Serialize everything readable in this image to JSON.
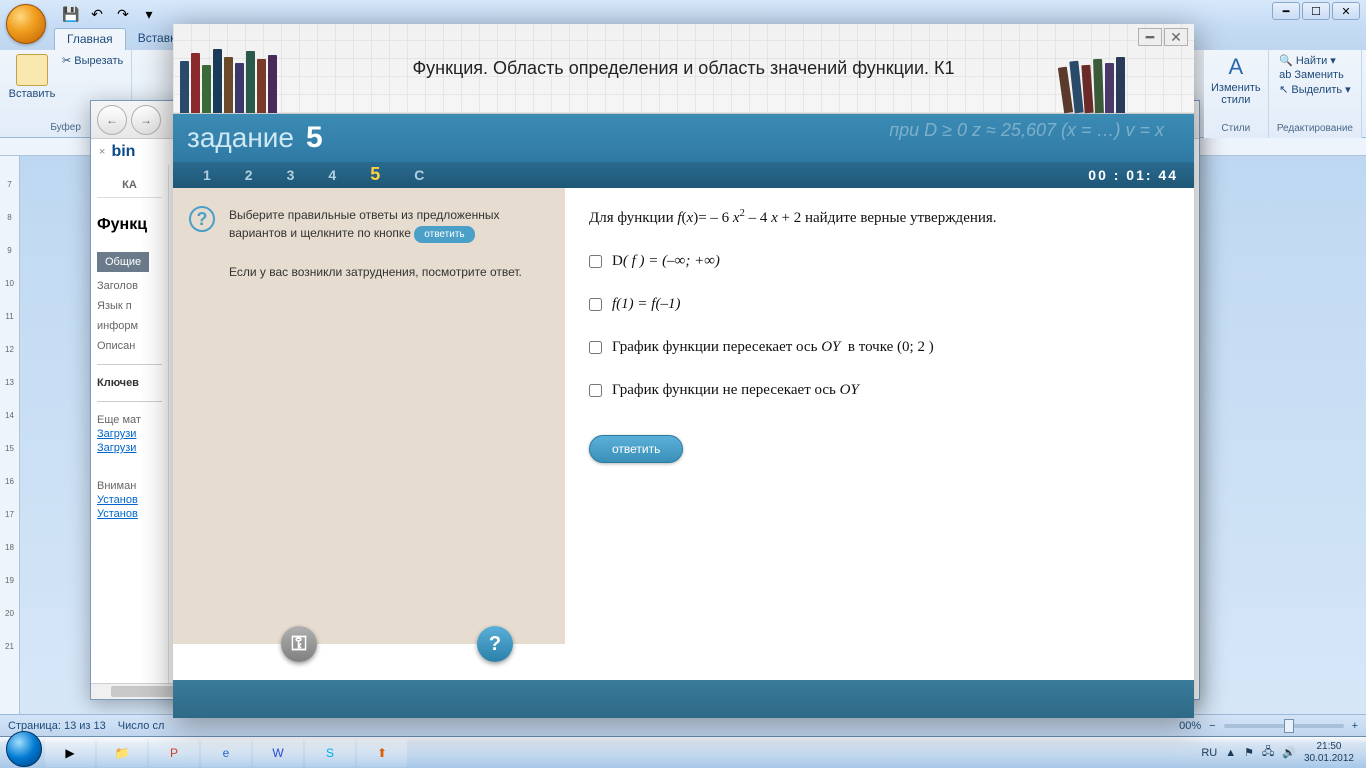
{
  "word": {
    "tabs": {
      "home": "Главная",
      "insert": "Вставка"
    },
    "clipboard": {
      "paste": "Вставить",
      "cut": "Вырезать",
      "label": "Буфер"
    },
    "styles": {
      "change": "Изменить\nстили",
      "label": "Стили"
    },
    "editing": {
      "find": "Найти",
      "replace": "Заменить",
      "select": "Выделить",
      "label": "Редактирование"
    },
    "status": {
      "page": "Страница: 13 из 13",
      "words": "Число сл",
      "zoom": "00%"
    }
  },
  "browser": {
    "bing": "bin",
    "tab_close": "×",
    "cat": "КА",
    "h1": "Функц",
    "tab_active": "Общие",
    "labels": {
      "zagolov": "Заголов",
      "yazyk": "Язык п",
      "inform": "информ",
      "opisan": "Описан",
      "kluchev": "Ключев",
      "more": "Еще мат",
      "warn": "Вниман"
    },
    "links": {
      "dl1": "Загрузи",
      "dl2": "Загрузи",
      "ust1": "Установ",
      "ust2": "Установ"
    }
  },
  "quiz": {
    "title": "Функция. Область определения и область значений функции. К1",
    "band_label": "задание",
    "band_num": "5",
    "band_math": "при D ≥ 0     z ≈ 25,607   (x = …)     v = x",
    "nav": [
      "1",
      "2",
      "3",
      "4",
      "5",
      "С"
    ],
    "nav_active": 4,
    "timer": "00 : 01: 44",
    "instr1_a": "Выберите правильные ответы из предложенных вариантов и щелкните по кнопке ",
    "instr1_pill": "ответить",
    "instr2": "Если у вас возникли затруднения,  посмотрите ответ.",
    "question_prefix": "Для функции ",
    "question_func": "f(x)= – 6 x² – 4 x + 2",
    "question_suffix": "   найдите верные утверждения.",
    "options": [
      "D( f ) = (–∞; +∞)",
      "f(1) = f(–1)",
      "График функции пересекает ось OY  в точке (0; 2 )",
      "График функции не пересекает ось OY"
    ],
    "answer_btn": "ответить"
  },
  "taskbar": {
    "lang": "RU",
    "time": "21:50",
    "date": "30.01.2012"
  }
}
